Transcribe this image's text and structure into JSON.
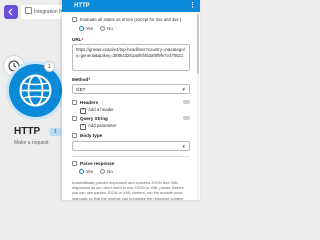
{
  "canvas": {
    "scenario_name": "Integration HTTP",
    "module": {
      "title": "HTTP",
      "number": "1",
      "subtitle": "Make a request",
      "badge": "1"
    }
  },
  "panel": {
    "title": "HTTP",
    "menu": "⋮",
    "evaluate_states": {
      "label": "Evaluate all states as errors (except for 2xx and 3xx )",
      "yes": "Yes",
      "no": "No",
      "selected": "Yes"
    },
    "url": {
      "label": "URL",
      "value": "https://gnews.io/api/v4/top-headlines?country=in&category=general&apikey=388643261a0f6f453af8f9fe7e270521"
    },
    "method": {
      "label": "Method",
      "value": "GET"
    },
    "headers": {
      "label": "Headers",
      "add": "Add a header"
    },
    "query_string": {
      "label": "Query String",
      "add": "Add parameter"
    },
    "body_type": {
      "label": "Body type",
      "value": ""
    },
    "parse_response": {
      "label": "Parse response",
      "yes": "Yes",
      "no": "No",
      "selected": "Yes",
      "help": "Automatically parses responses and converts JSON and XML responses so you don't need to use JSON or XML parser. Before you can use parsed JSON or XML content, run the module once manually so that the module can recognize the response content"
    }
  }
}
